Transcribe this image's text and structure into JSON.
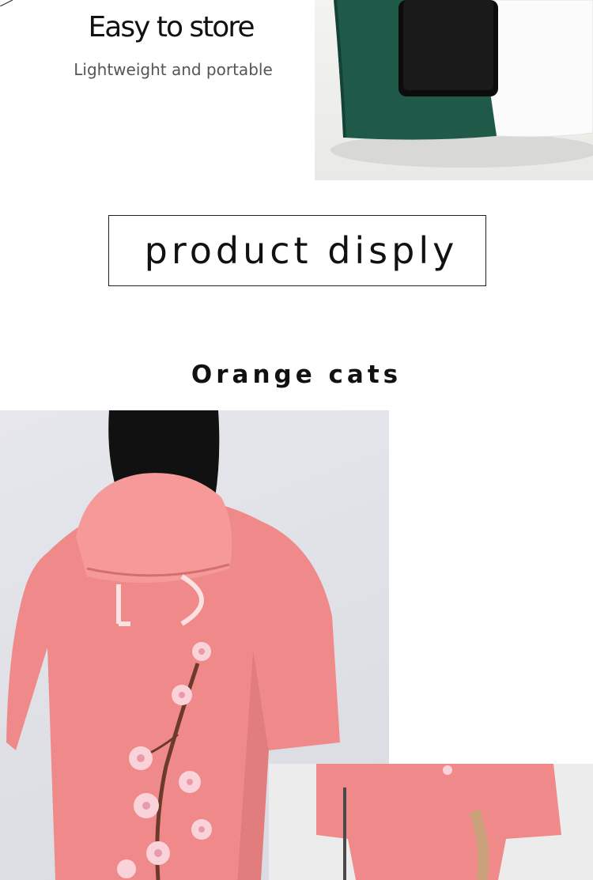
{
  "store_section": {
    "title": "Easy to store",
    "subtitle": "Lightweight and portable"
  },
  "product_section": {
    "heading": "product disply",
    "variant_title": "Orange cats"
  },
  "colors": {
    "hoodie_pink": "#f08a8a",
    "pillow_green": "#1f5a48",
    "text_dark": "#111111"
  }
}
